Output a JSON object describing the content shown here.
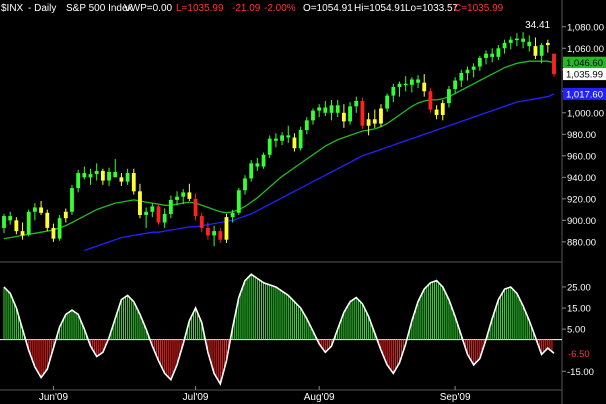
{
  "header": {
    "ticker": "$INX",
    "sep": "- Daily",
    "index_name": "S&P 500 Index",
    "vwp": "VWP=0.00",
    "last": "L=1035.99",
    "change": "-21.09",
    "change_pct": "-2.00%",
    "open": "O=1054.91",
    "high": "Hi=1054.91",
    "low": "Lo=1033.57",
    "close": "C=1035.99"
  },
  "colors": {
    "background": "#000000",
    "text": "#ffffff",
    "negative": "#ff3333",
    "bar_green": "#33ff33",
    "bar_yellow": "#ffff33",
    "bar_red": "#ff2222",
    "sma_short": "#22bb22",
    "sma_long": "#2222ff",
    "osc_pos": "#33dd33",
    "osc_neg": "#ff2222",
    "osc_line": "#ffffff",
    "grid": "#666666"
  },
  "chart_data": [
    {
      "type": "candlestick",
      "title": "$INX - Daily S&P 500 Index",
      "ylim": [
        865,
        1090
      ],
      "y_ticks": [
        880,
        900,
        920,
        940,
        960,
        980,
        1000,
        1020,
        1040,
        1060,
        1080
      ],
      "y_tick_labels": [
        "880.00",
        "900.00",
        "920.00",
        "940.00",
        "960.00",
        "980.00",
        "1,000.00",
        "1,020.00",
        "",
        "1,060.00",
        "1,080.00"
      ],
      "price_labels": [
        {
          "text": "1,046.60",
          "value": 1046.6,
          "color": "sma_short"
        },
        {
          "text": "1,035.99",
          "value": 1035.99,
          "color": "white"
        },
        {
          "text": "1,017.60",
          "value": 1017.6,
          "color": "sma_long"
        }
      ],
      "peak_annotation": "34.41",
      "x_labels": [
        {
          "text": "Jun'09",
          "index": 8
        },
        {
          "text": "Jul'09",
          "index": 31
        },
        {
          "text": "Aug'09",
          "index": 51
        },
        {
          "text": "Sep'09",
          "index": 73
        }
      ],
      "series": [
        {
          "name": "OHLC",
          "ohlc": [
            [
              893,
              906,
              888,
              904,
              "g"
            ],
            [
              904,
              908,
              896,
              900,
              "g"
            ],
            [
              900,
              903,
              887,
              890,
              "y"
            ],
            [
              890,
              898,
              882,
              886,
              "y"
            ],
            [
              887,
              910,
              885,
              908,
              "g"
            ],
            [
              908,
              916,
              900,
              912,
              "g"
            ],
            [
              912,
              918,
              905,
              907,
              "y"
            ],
            [
              907,
              910,
              890,
              893,
              "y"
            ],
            [
              893,
              897,
              880,
              883,
              "y"
            ],
            [
              883,
              905,
              881,
              902,
              "g"
            ],
            [
              902,
              911,
              898,
              908,
              "y"
            ],
            [
              908,
              933,
              905,
              930,
              "g"
            ],
            [
              930,
              947,
              926,
              944,
              "g"
            ],
            [
              944,
              950,
              938,
              940,
              "g"
            ],
            [
              940,
              948,
              933,
              943,
              "g"
            ],
            [
              943,
              953,
              937,
              946,
              "g"
            ],
            [
              946,
              948,
              933,
              937,
              "y"
            ],
            [
              937,
              949,
              932,
              945,
              "g"
            ],
            [
              945,
              957,
              941,
              940,
              "g"
            ],
            [
              940,
              944,
              932,
              936,
              "y"
            ],
            [
              936,
              948,
              933,
              944,
              "g"
            ],
            [
              944,
              948,
              924,
              927,
              "y"
            ],
            [
              927,
              934,
              902,
              905,
              "y"
            ],
            [
              905,
              912,
              893,
              908,
              "g"
            ],
            [
              908,
              916,
              903,
              913,
              "g"
            ],
            [
              913,
              915,
              896,
              898,
              "r"
            ],
            [
              898,
              911,
              893,
              906,
              "g"
            ],
            [
              906,
              923,
              902,
              919,
              "g"
            ],
            [
              919,
              927,
              914,
              922,
              "g"
            ],
            [
              922,
              929,
              915,
              926,
              "g"
            ],
            [
              926,
              934,
              918,
              920,
              "y"
            ],
            [
              920,
              925,
              900,
              904,
              "r"
            ],
            [
              904,
              907,
              889,
              893,
              "r"
            ],
            [
              893,
              898,
              882,
              886,
              "r"
            ],
            [
              886,
              895,
              876,
              890,
              "g"
            ],
            [
              890,
              893,
              879,
              882,
              "r"
            ],
            [
              882,
              906,
              879,
              903,
              "y"
            ],
            [
              903,
              910,
              898,
              907,
              "g"
            ],
            [
              907,
              930,
              905,
              928,
              "g"
            ],
            [
              928,
              942,
              924,
              939,
              "g"
            ],
            [
              939,
              956,
              936,
              953,
              "g"
            ],
            [
              953,
              958,
              946,
              950,
              "g"
            ],
            [
              950,
              963,
              948,
              961,
              "g"
            ],
            [
              961,
              979,
              958,
              976,
              "g"
            ],
            [
              976,
              981,
              968,
              974,
              "g"
            ],
            [
              974,
              982,
              970,
              979,
              "g"
            ],
            [
              979,
              988,
              972,
              977,
              "g"
            ],
            [
              977,
              981,
              964,
              967,
              "y"
            ],
            [
              967,
              987,
              965,
              984,
              "g"
            ],
            [
              984,
              996,
              980,
              993,
              "g"
            ],
            [
              993,
              1004,
              989,
              1002,
              "g"
            ],
            [
              1002,
              1008,
              996,
              1005,
              "g"
            ],
            [
              1005,
              1011,
              997,
              1000,
              "g"
            ],
            [
              1000,
              1012,
              993,
              1007,
              "g"
            ],
            [
              1007,
              1012,
              996,
              1000,
              "g"
            ],
            [
              1000,
              1008,
              986,
              992,
              "y"
            ],
            [
              992,
              1010,
              989,
              1006,
              "g"
            ],
            [
              1006,
              1015,
              1000,
              1011,
              "g"
            ],
            [
              1011,
              1014,
              985,
              988,
              "r"
            ],
            [
              988,
              1000,
              979,
              994,
              "y"
            ],
            [
              994,
              1003,
              986,
              990,
              "y"
            ],
            [
              990,
              1008,
              987,
              1004,
              "y"
            ],
            [
              1004,
              1018,
              1001,
              1016,
              "g"
            ],
            [
              1016,
              1027,
              1010,
              1024,
              "g"
            ],
            [
              1024,
              1029,
              1015,
              1027,
              "g"
            ],
            [
              1027,
              1034,
              1020,
              1026,
              "g"
            ],
            [
              1026,
              1033,
              1019,
              1031,
              "g"
            ],
            [
              1031,
              1035,
              1023,
              1028,
              "g"
            ],
            [
              1028,
              1036,
              1015,
              1020,
              "y"
            ],
            [
              1020,
              1023,
              1000,
              1003,
              "r"
            ],
            [
              1003,
              1007,
              994,
              998,
              "y"
            ],
            [
              998,
              1012,
              993,
              1009,
              "y"
            ],
            [
              1009,
              1025,
              1005,
              1022,
              "g"
            ],
            [
              1022,
              1033,
              1018,
              1030,
              "g"
            ],
            [
              1030,
              1040,
              1024,
              1037,
              "g"
            ],
            [
              1037,
              1043,
              1030,
              1040,
              "g"
            ],
            [
              1040,
              1046,
              1033,
              1043,
              "g"
            ],
            [
              1043,
              1053,
              1039,
              1051,
              "g"
            ],
            [
              1051,
              1058,
              1045,
              1055,
              "g"
            ],
            [
              1055,
              1060,
              1047,
              1052,
              "g"
            ],
            [
              1052,
              1063,
              1049,
              1060,
              "g"
            ],
            [
              1060,
              1068,
              1055,
              1065,
              "g"
            ],
            [
              1065,
              1071,
              1059,
              1068,
              "g"
            ],
            [
              1068,
              1074,
              1062,
              1069,
              "g"
            ],
            [
              1069,
              1075,
              1060,
              1066,
              "g"
            ],
            [
              1066,
              1072,
              1057,
              1062,
              "g"
            ],
            [
              1062,
              1070,
              1050,
              1053,
              "y"
            ],
            [
              1053,
              1065,
              1046,
              1063,
              "g"
            ],
            [
              1063,
              1068,
              1056,
              1065,
              "y"
            ],
            [
              1054.91,
              1054.91,
              1033.57,
              1035.99,
              "r"
            ]
          ]
        },
        {
          "name": "SMA short",
          "values": [
            883,
            884,
            885,
            886,
            887,
            888,
            889,
            890,
            891,
            893,
            895,
            898,
            901,
            904,
            907,
            910,
            912,
            914,
            916,
            917,
            918,
            919,
            918,
            917,
            916,
            915,
            914,
            914,
            915,
            916,
            917,
            916,
            914,
            912,
            910,
            908,
            907,
            908,
            910,
            913,
            917,
            921,
            926,
            931,
            936,
            941,
            945,
            949,
            953,
            957,
            961,
            965,
            969,
            972,
            975,
            977,
            979,
            981,
            983,
            984,
            985,
            987,
            990,
            994,
            998,
            1002,
            1006,
            1009,
            1011,
            1012,
            1012,
            1013,
            1015,
            1018,
            1021,
            1024,
            1027,
            1030,
            1033,
            1036,
            1039,
            1042,
            1044,
            1046,
            1047,
            1048,
            1048,
            1048,
            1048,
            1046.6
          ]
        },
        {
          "name": "SMA long",
          "values": [
            null,
            null,
            null,
            null,
            null,
            null,
            null,
            null,
            null,
            null,
            null,
            null,
            null,
            872,
            874,
            876,
            878,
            880,
            882,
            884,
            885,
            886,
            887,
            888,
            889,
            889,
            890,
            891,
            892,
            893,
            894,
            894,
            895,
            896,
            897,
            898,
            899,
            900,
            902,
            904,
            906,
            909,
            912,
            915,
            918,
            921,
            924,
            927,
            930,
            933,
            936,
            939,
            942,
            945,
            948,
            951,
            954,
            957,
            960,
            962,
            964,
            966,
            968,
            970,
            972,
            974,
            976,
            978,
            980,
            982,
            984,
            986,
            988,
            990,
            992,
            994,
            996,
            998,
            1000,
            1002,
            1004,
            1006,
            1008,
            1010,
            1011,
            1012,
            1013,
            1014,
            1015,
            1017.6
          ]
        }
      ]
    },
    {
      "type": "histogram",
      "ylim": [
        -22,
        34
      ],
      "y_ticks": [
        25,
        15,
        5,
        -15
      ],
      "y_tick_labels": [
        "25.00",
        "15.00",
        "5.00",
        "-15.00"
      ],
      "current_value": -6.5,
      "current_label": "-6.50",
      "values": [
        25,
        22,
        15,
        5,
        -5,
        -13,
        -18,
        -14,
        -4,
        6,
        12,
        14,
        12,
        5,
        -3,
        -8,
        -6,
        1,
        10,
        19,
        21,
        18,
        12,
        5,
        -3,
        -10,
        -16,
        -19,
        -12,
        -2,
        9,
        15,
        8,
        -6,
        -16,
        -21,
        -10,
        6,
        20,
        28,
        31,
        29,
        27,
        26,
        25,
        23,
        21,
        18,
        15,
        10,
        4,
        -2,
        -6,
        -3,
        5,
        13,
        18,
        20,
        17,
        11,
        3,
        -5,
        -12,
        -16,
        -11,
        -2,
        9,
        18,
        24,
        27,
        28,
        25,
        19,
        11,
        2,
        -7,
        -12,
        -9,
        0,
        10,
        19,
        24,
        25,
        22,
        16,
        9,
        1,
        -7,
        -4,
        -6.5
      ]
    }
  ]
}
